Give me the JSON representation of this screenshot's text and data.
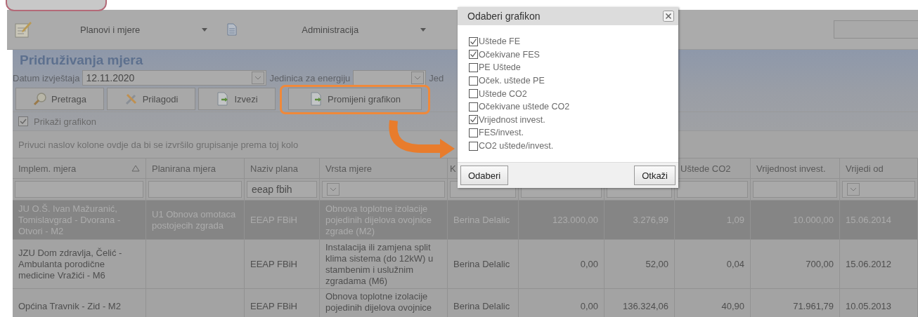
{
  "toolbar": {
    "menus": [
      {
        "label": "Planovi i mjere"
      },
      {
        "label": "Administracija"
      }
    ]
  },
  "panel": {
    "title": "Pridruživanja mjera",
    "report_date": {
      "label": "Datum izvještaja",
      "value": "12.11.2020"
    },
    "energy_unit": {
      "label": "Jedinica za energiju"
    },
    "cut_label": "Jed",
    "buttons": [
      {
        "label": "Pretraga",
        "highlighted": false
      },
      {
        "label": "Prilagodi",
        "highlighted": false
      },
      {
        "label": "Izvezi",
        "highlighted": false
      },
      {
        "label": "Promijeni grafikon",
        "highlighted": true
      }
    ],
    "show_chart": {
      "label": "Prikaži grafikon",
      "checked": true
    },
    "group_hint": "Privuci naslov kolone ovdje da bi se izvršilo grupisanje prema toj kolo"
  },
  "table": {
    "columns": [
      {
        "label": "Implem. mjera",
        "sorted": true
      },
      {
        "label": "Planirana mjera"
      },
      {
        "label": "Naziv plana"
      },
      {
        "label": "Vrsta mjere"
      },
      {
        "label": "K"
      },
      {},
      {},
      {
        "label": "Uštede CO2"
      },
      {
        "label": "Vrijednost invest."
      },
      {
        "label": "Vrijedi od"
      }
    ],
    "filters": [
      {
        "dropdown": false
      },
      {
        "dropdown": false
      },
      {
        "value": "eeap fbih",
        "dropdown": false
      },
      {
        "dropdown": true
      },
      {
        "dropdown": false
      },
      {
        "dropdown": false
      },
      {
        "dropdown": false
      },
      {
        "dropdown": false
      },
      {
        "dropdown": false
      },
      {
        "dropdown": true
      }
    ],
    "rows": [
      {
        "selected": true,
        "cells": [
          "JU O.Š. Ivan Mažuranić, Tomislavgrad - Dvorana - Otvori - M2",
          "U1 Obnova omotaca postojecih zgrada",
          "EEAP FBiH",
          "Obnova toplotne izolacije pojedinih dijelova ovojnice zgrade (M2)",
          "Berina Delalic",
          "123.000,00",
          "3.276,99",
          "1,09",
          "10.000,00",
          "15.06.2014"
        ]
      },
      {
        "selected": false,
        "cells": [
          "JZU Dom zdravlja, Čelić - Ambulanta porodične medicine Vražići - M6",
          "",
          "EEAP FBiH",
          "Instalacija ili zamjena split klima sistema (do 12kW) u stambenim i uslužnim zgradama (M6)",
          "Berina Delalic",
          "0,00",
          "52,00",
          "0,04",
          "700,00",
          "15.06.2012"
        ]
      },
      {
        "selected": false,
        "cells": [
          "Općina Travnik - Zid - M2",
          "",
          "EEAP FBiH",
          "Obnova toplotne izolacije pojedinih dijelova ovojnice",
          "Berina Delalic",
          "0,00",
          "136.324,06",
          "40,90",
          "71.961,79",
          "10.05.2013"
        ]
      }
    ]
  },
  "dialog": {
    "title": "Odaberi grafikon",
    "options": [
      {
        "label": "Uštede FE",
        "checked": true
      },
      {
        "label": "Očekivane FES",
        "checked": true
      },
      {
        "label": "PE Uštede",
        "checked": false
      },
      {
        "label": "Oček. uštede PE",
        "checked": false
      },
      {
        "label": "Uštede CO2",
        "checked": false
      },
      {
        "label": "Očekivane uštede CO2",
        "checked": false
      },
      {
        "label": "Vrijednost invest.",
        "checked": true
      },
      {
        "label": "FES/invest.",
        "checked": false
      },
      {
        "label": "CO2 uštede/invest.",
        "checked": false
      }
    ],
    "buttons": [
      "Odaberi",
      "Otkaži"
    ]
  }
}
